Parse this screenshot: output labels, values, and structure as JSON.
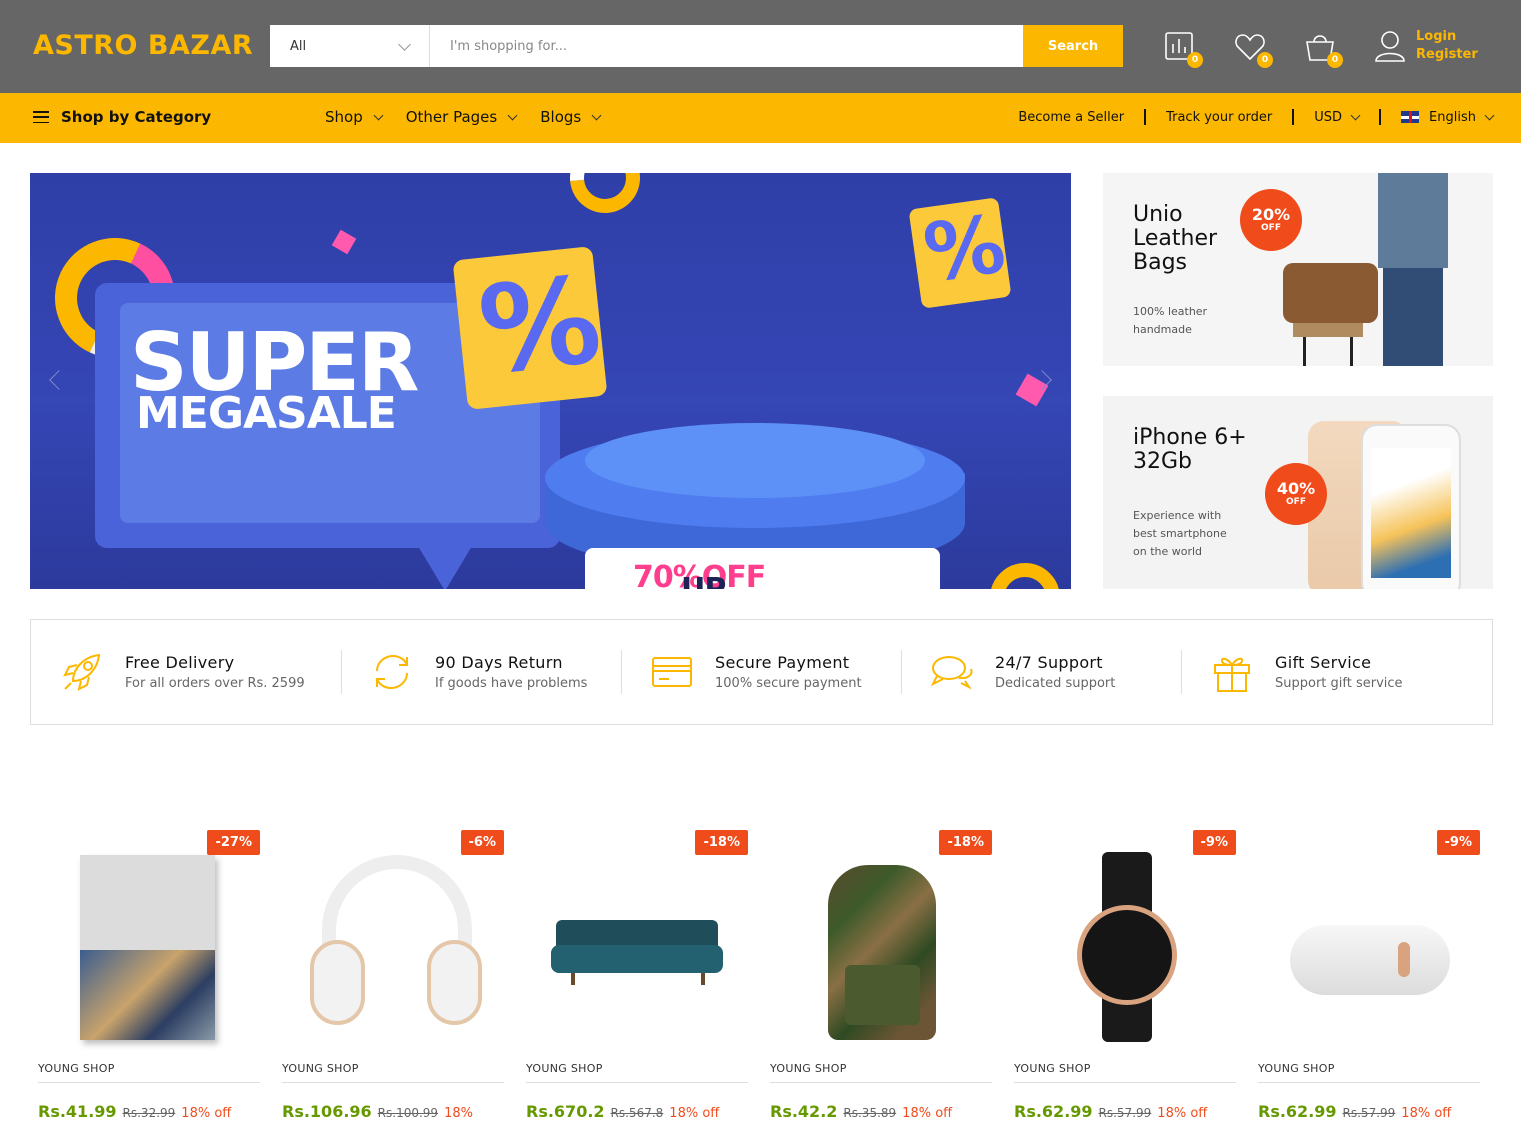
{
  "header": {
    "logo": "ASTRO BAZAR",
    "category_select": "All",
    "search_placeholder": "I'm shopping for...",
    "search_button": "Search",
    "compare_count": "0",
    "wishlist_count": "0",
    "cart_count": "0",
    "login": "Login",
    "register": "Register"
  },
  "nav": {
    "shop_by_category": "Shop by Category",
    "menu": [
      "Shop",
      "Other Pages",
      "Blogs"
    ],
    "become_seller": "Become a Seller",
    "track_order": "Track your order",
    "currency": "USD",
    "language": "English"
  },
  "hero": {
    "line1": "SUPER",
    "line2": "MEGASALE",
    "tag_prefix": "UP TO ",
    "tag_highlight": "70%OFF"
  },
  "promos": [
    {
      "title_lines": [
        "Unio",
        "Leather",
        "Bags"
      ],
      "sub_lines": [
        "100% leather",
        "handmade"
      ],
      "discount": "20%",
      "off": "OFF"
    },
    {
      "title_lines": [
        "iPhone 6+",
        "32Gb"
      ],
      "sub_lines": [
        "Experience with",
        "best smartphone",
        "on the world"
      ],
      "discount": "40%",
      "off": "OFF"
    }
  ],
  "features": [
    {
      "icon": "rocket-icon",
      "title": "Free Delivery",
      "sub": "For all orders over Rs. 2599"
    },
    {
      "icon": "refresh-icon",
      "title": "90 Days Return",
      "sub": "If goods have problems"
    },
    {
      "icon": "credit-card-icon",
      "title": "Secure Payment",
      "sub": "100% secure payment"
    },
    {
      "icon": "chat-icon",
      "title": "24/7 Support",
      "sub": "Dedicated support"
    },
    {
      "icon": "gift-icon",
      "title": "Gift Service",
      "sub": "Support gift service"
    }
  ],
  "products": [
    {
      "badge": "-27%",
      "vendor": "YOUNG SHOP",
      "price": "Rs.41.99",
      "old": "Rs.32.99",
      "off": "18% off",
      "image": "book"
    },
    {
      "badge": "-6%",
      "vendor": "YOUNG SHOP",
      "price": "Rs.106.96",
      "old": "Rs.100.99",
      "off": "18%",
      "image": "headphones"
    },
    {
      "badge": "-18%",
      "vendor": "YOUNG SHOP",
      "price": "Rs.670.2",
      "old": "Rs.567.8",
      "off": "18% off",
      "image": "sofa"
    },
    {
      "badge": "-18%",
      "vendor": "YOUNG SHOP",
      "price": "Rs.42.2",
      "old": "Rs.35.89",
      "off": "18% off",
      "image": "backpack"
    },
    {
      "badge": "-9%",
      "vendor": "YOUNG SHOP",
      "price": "Rs.62.99",
      "old": "Rs.57.99",
      "off": "18% off",
      "image": "watch"
    },
    {
      "badge": "-9%",
      "vendor": "YOUNG SHOP",
      "price": "Rs.62.99",
      "old": "Rs.57.99",
      "off": "18% off",
      "image": "speaker"
    }
  ],
  "colors": {
    "accent": "#fcb800",
    "header_bg": "#666666",
    "badge": "#f04b1b",
    "price": "#669900"
  }
}
